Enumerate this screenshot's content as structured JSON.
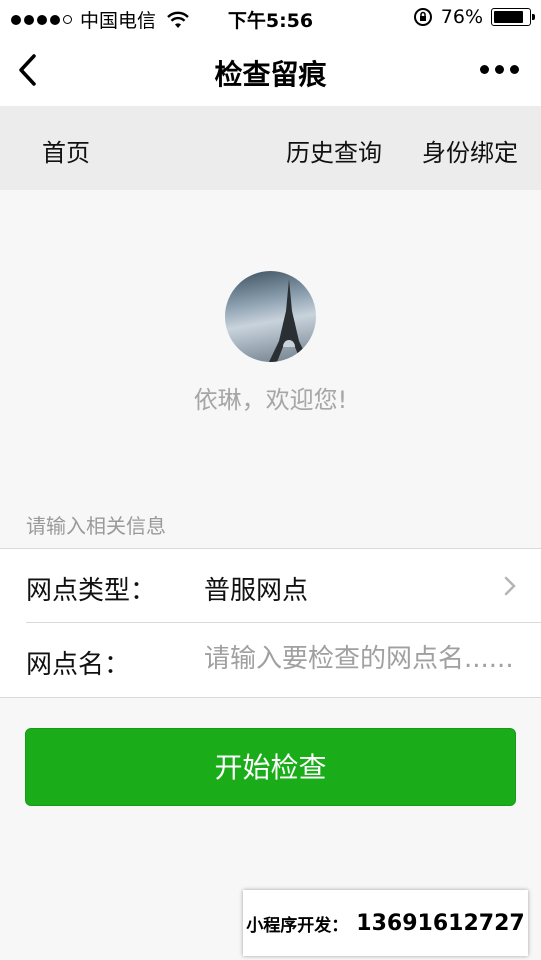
{
  "status_bar": {
    "carrier": "中国电信",
    "time": "下午5:56",
    "battery_percent": "76%",
    "battery_level": 0.76,
    "icons": [
      "signal-dots-icon",
      "wifi-icon",
      "rotation-lock-icon",
      "battery-icon"
    ]
  },
  "nav": {
    "title": "检查留痕",
    "icons": [
      "back-arrow-icon",
      "more-dots-icon"
    ]
  },
  "tabs": [
    {
      "label": "首页"
    },
    {
      "label": "历史查询"
    },
    {
      "label": "身份绑定"
    }
  ],
  "profile": {
    "greeting": "依琳，欢迎您!"
  },
  "form": {
    "section_label": "请输入相关信息",
    "type_label": "网点类型：",
    "type_value": "普服网点",
    "name_label": "网点名：",
    "name_placeholder": "请输入要检查的网点名......"
  },
  "actions": {
    "start_label": "开始检查"
  },
  "promo": {
    "label": "小程序开发：",
    "phone": "13691612727"
  },
  "colors": {
    "primary_button": "#1aad19",
    "tab_bar_bg": "#ececec",
    "page_bg": "#f7f7f7",
    "muted_text": "#a6a6a6"
  }
}
